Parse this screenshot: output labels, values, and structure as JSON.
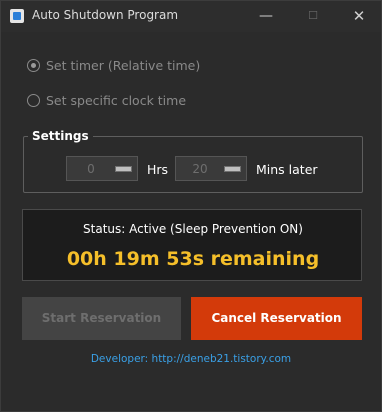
{
  "window": {
    "title": "Auto Shutdown Program",
    "controls": {
      "minimize": "—",
      "maximize": "☐",
      "close": "✕"
    }
  },
  "mode": {
    "options": [
      {
        "label": "Set timer (Relative time)",
        "checked": true,
        "enabled": false
      },
      {
        "label": "Set specific clock time",
        "checked": false,
        "enabled": false
      }
    ]
  },
  "settings": {
    "title": "Settings",
    "hours_value": "0",
    "hours_label": "Hrs",
    "minutes_value": "20",
    "minutes_label": "Mins later"
  },
  "status": {
    "text": "Status: Active (Sleep Prevention ON)",
    "remaining": "00h 19m 53s remaining"
  },
  "buttons": {
    "start_label": "Start Reservation",
    "cancel_label": "Cancel Reservation"
  },
  "footer": {
    "developer": "Developer: http://deneb21.tistory.com"
  },
  "colors": {
    "background": "#2b2b2b",
    "countdown": "#f5bf2a",
    "cancel_button": "#d33a0a",
    "link": "#3aa0e6"
  }
}
